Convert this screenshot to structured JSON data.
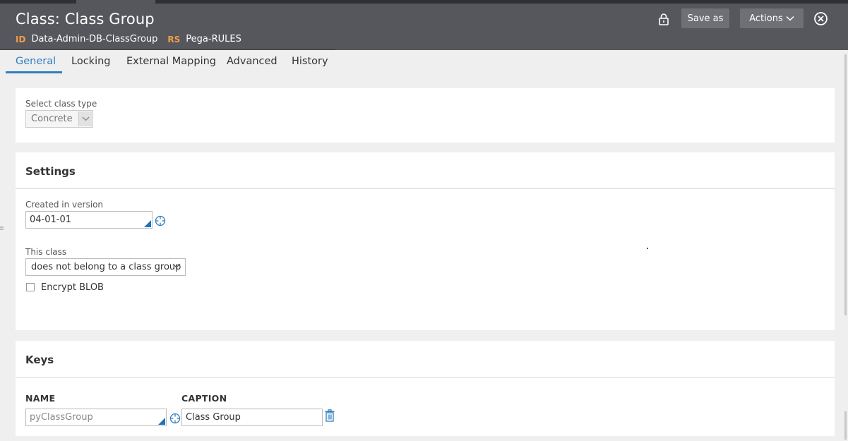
{
  "header": {
    "title": "Class: Class Group",
    "id_label": "ID",
    "id_value": "Data-Admin-DB-ClassGroup",
    "rs_label": "RS",
    "rs_value": "Pega-RULES",
    "save_as_label": "Save as",
    "actions_label": "Actions"
  },
  "tabs": [
    {
      "label": "General"
    },
    {
      "label": "Locking"
    },
    {
      "label": "External Mapping"
    },
    {
      "label": "Advanced"
    },
    {
      "label": "History"
    }
  ],
  "class_type": {
    "label": "Select class type",
    "value": "Concrete"
  },
  "settings": {
    "heading": "Settings",
    "version_label": "Created in version",
    "version_value": "04-01-01",
    "this_class_label": "This class",
    "this_class_value": "does not belong to a class group",
    "encrypt_label": "Encrypt BLOB",
    "encrypt_checked": false
  },
  "keys": {
    "heading": "Keys",
    "name_header": "NAME",
    "caption_header": "CAPTION",
    "rows": [
      {
        "name": "pyClassGroup",
        "caption": "Class Group"
      }
    ]
  },
  "colors": {
    "header_bg": "#55575c",
    "accent": "#2f7fbf",
    "label_orange": "#f39c4b"
  },
  "icons": [
    "lock-icon",
    "chevron-down-icon",
    "close-circle-icon",
    "crosshair-icon",
    "trash-icon"
  ]
}
